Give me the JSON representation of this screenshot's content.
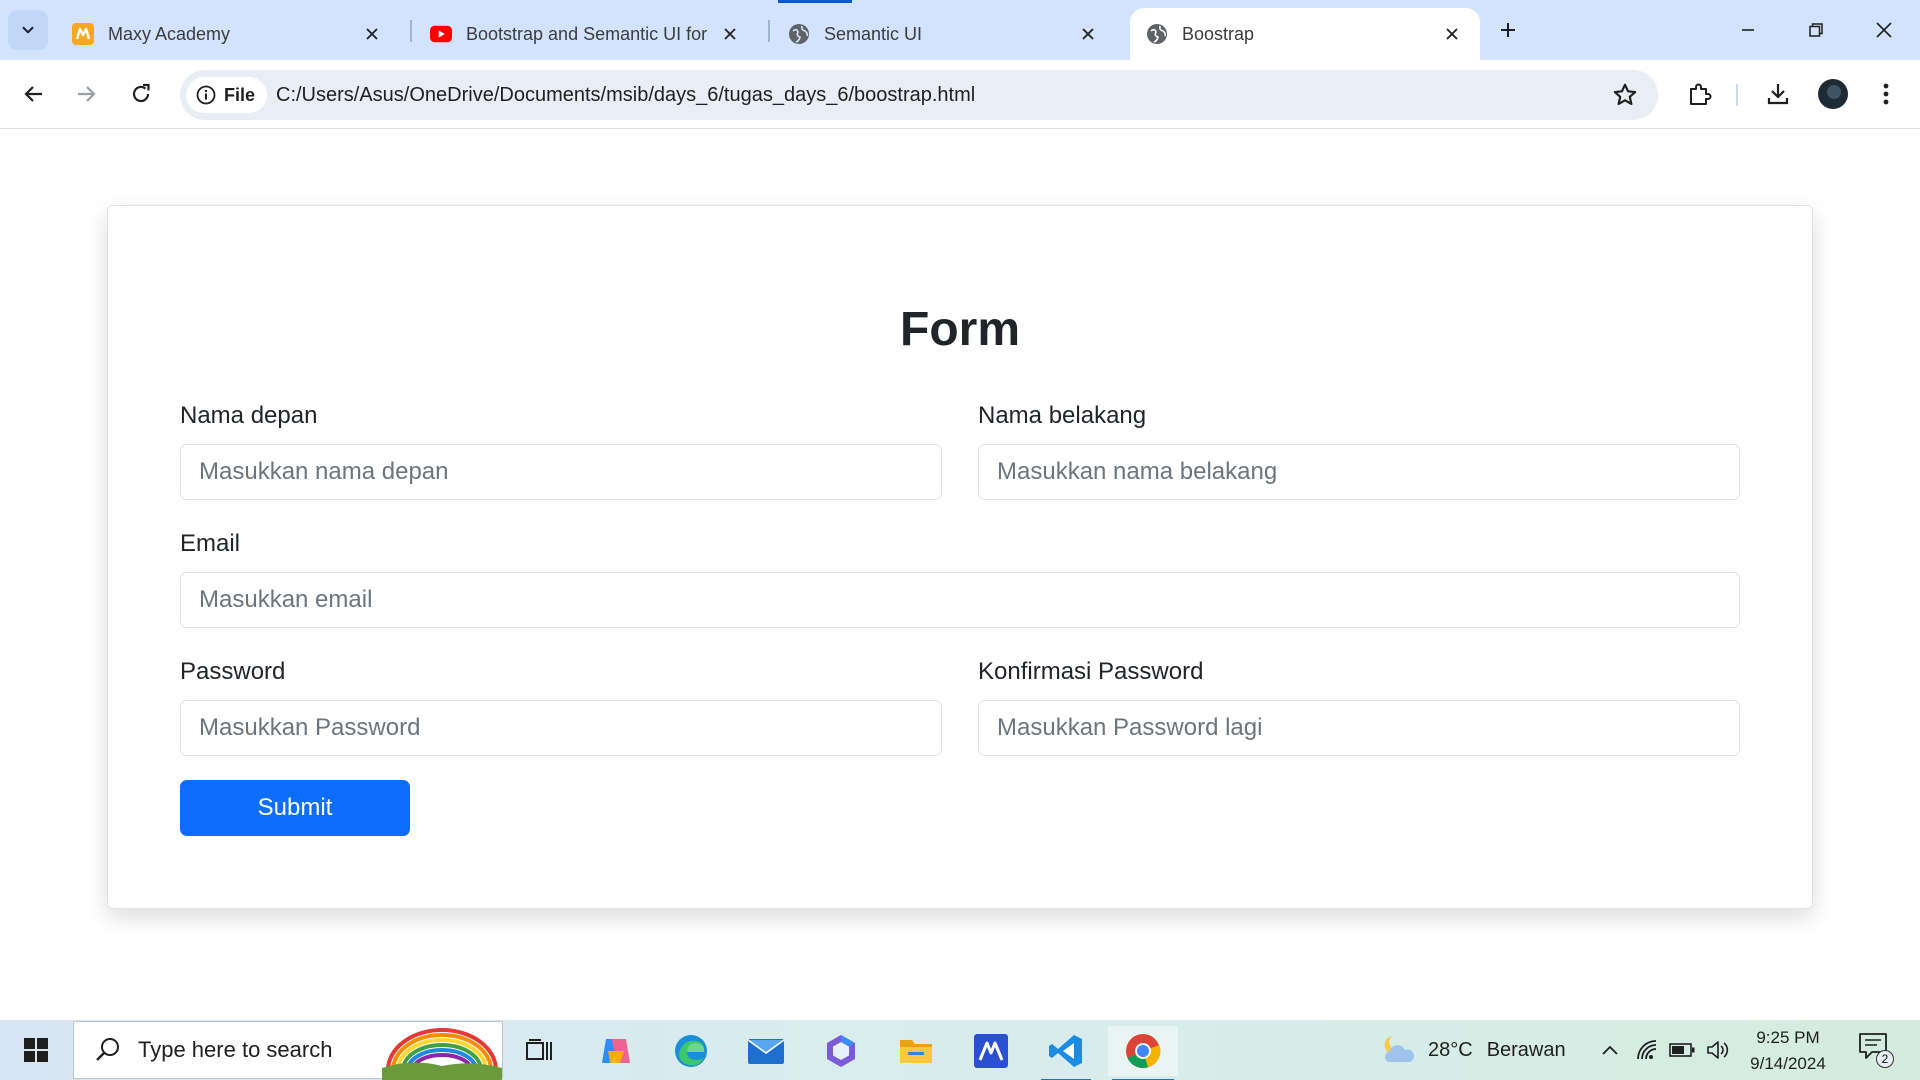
{
  "browser": {
    "tabs": [
      {
        "title": "Maxy Academy",
        "favicon": "maxy-academy-icon",
        "favicon_color": "#f7a823"
      },
      {
        "title": "Bootstrap and Semantic UI for E",
        "favicon": "youtube-icon",
        "favicon_color": "#ff0000"
      },
      {
        "title": "Semantic UI",
        "favicon": "globe-icon",
        "favicon_color": "#5f6368"
      },
      {
        "title": "Boostrap",
        "favicon": "globe-icon",
        "favicon_color": "#5f6368",
        "active": true
      }
    ],
    "address_bar": {
      "chip_label": "File",
      "url": "C:/Users/Asus/OneDrive/Documents/msib/days_6/tugas_days_6/boostrap.html"
    }
  },
  "page": {
    "title": "Form",
    "fields": {
      "first_name": {
        "label": "Nama depan",
        "placeholder": "Masukkan nama depan",
        "value": ""
      },
      "last_name": {
        "label": "Nama belakang",
        "placeholder": "Masukkan nama belakang",
        "value": ""
      },
      "email": {
        "label": "Email",
        "placeholder": "Masukkan email",
        "value": ""
      },
      "password": {
        "label": "Password",
        "placeholder": "Masukkan Password",
        "value": ""
      },
      "confirm_password": {
        "label": "Konfirmasi Password",
        "placeholder": "Masukkan Password lagi",
        "value": ""
      }
    },
    "submit_label": "Submit",
    "accent_color": "#0d6efd"
  },
  "taskbar": {
    "search_placeholder": "Type here to search",
    "pinned_apps": [
      "task-view-icon",
      "copilot-icon",
      "edge-icon",
      "mail-icon",
      "m365-icon",
      "file-explorer-icon",
      "maxy-app-icon",
      "vscode-icon",
      "chrome-icon"
    ],
    "weather": {
      "temperature": "28°C",
      "condition": "Berawan"
    },
    "clock": {
      "time": "9:25 PM",
      "date": "9/14/2024"
    },
    "notification_count": "2"
  }
}
